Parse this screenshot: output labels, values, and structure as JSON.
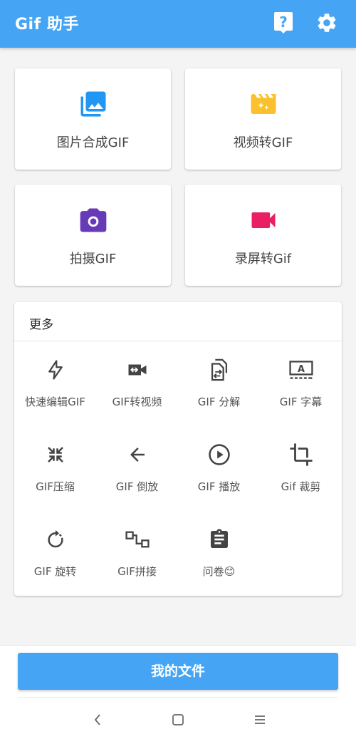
{
  "appbar": {
    "title": "Gif 助手",
    "help_icon": "help-bubble-icon",
    "settings_icon": "gear-icon",
    "color": "#45a5f4"
  },
  "main_actions": [
    {
      "label": "图片合成GIF",
      "icon": "photo-library-icon",
      "color": "#2196f3"
    },
    {
      "label": "视频转GIF",
      "icon": "movie-clapper-icon",
      "color": "#fbc02d"
    },
    {
      "label": "拍摄GIF",
      "icon": "camera-icon",
      "color": "#673ab7"
    },
    {
      "label": "录屏转Gif",
      "icon": "videocam-icon",
      "color": "#e91e63"
    }
  ],
  "more": {
    "title": "更多",
    "tools": [
      {
        "label": "快速编辑GIF",
        "icon": "flash-icon"
      },
      {
        "label": "GIF转视频",
        "icon": "video-convert-icon"
      },
      {
        "label": "GIF 分解",
        "icon": "split-file-icon"
      },
      {
        "label": "GIF 字幕",
        "icon": "subtitle-icon"
      },
      {
        "label": "GIF压缩",
        "icon": "compress-icon"
      },
      {
        "label": "GIF 倒放",
        "icon": "arrow-left-icon"
      },
      {
        "label": "GIF 播放",
        "icon": "play-circle-icon"
      },
      {
        "label": "Gif 裁剪",
        "icon": "crop-icon"
      },
      {
        "label": "GIF 旋转",
        "icon": "rotate-icon"
      },
      {
        "label": "GIF拼接",
        "icon": "join-icon"
      },
      {
        "label": "问卷😊",
        "icon": "clipboard-icon"
      }
    ]
  },
  "bottom": {
    "my_files_label": "我的文件"
  },
  "navbar": {
    "back_icon": "back-chevron-icon",
    "home_icon": "home-square-icon",
    "menu_icon": "menu-lines-icon"
  }
}
